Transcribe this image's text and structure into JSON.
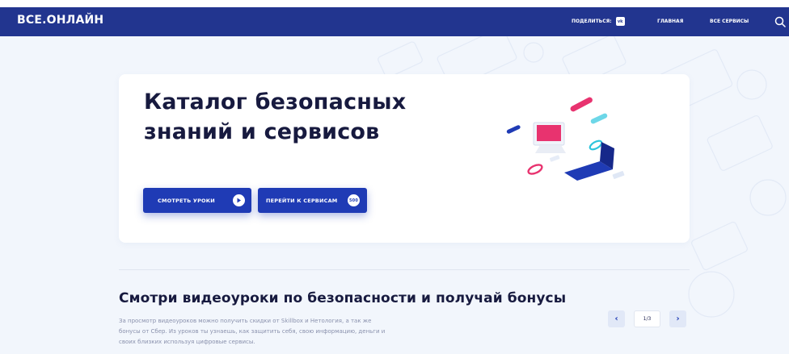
{
  "header": {
    "logo": "ВСЕ.ОНЛАЙН",
    "share_label": "ПОДЕЛИТЬСЯ:",
    "share_icon": "vk-icon",
    "nav": [
      "ГЛАВНАЯ",
      "ВСЕ СЕРВИСЫ"
    ],
    "search_icon": "search-icon"
  },
  "hero": {
    "title_line1": "Каталог безопасных",
    "title_line2": "знаний и сервисов",
    "buttons": {
      "lessons": {
        "label": "СМОТРЕТЬ УРОКИ",
        "icon": "play-icon"
      },
      "services": {
        "label": "ПЕРЕЙТИ К СЕРВИСАМ",
        "badge": "500"
      }
    }
  },
  "section": {
    "title": "Смотри видеоуроки по безопасности и получай бонусы",
    "description_lines": [
      "За просмотр видеоуроков можно получить скидки от Skillbox и Нетология, а так же",
      "бонусы от Сбер. Из уроков ты узнаешь, как защитить себя, свою информацию, деньги и",
      "своих близких используя цифровые сервисы."
    ]
  },
  "pager": {
    "prev": "‹",
    "next": "›",
    "counter": "1/3"
  },
  "colors": {
    "header_bg": "#22358f",
    "accent": "#1f3bb5",
    "page_bg": "#f2f6fc",
    "pink": "#e8336f",
    "cyan": "#2ec5dc"
  }
}
